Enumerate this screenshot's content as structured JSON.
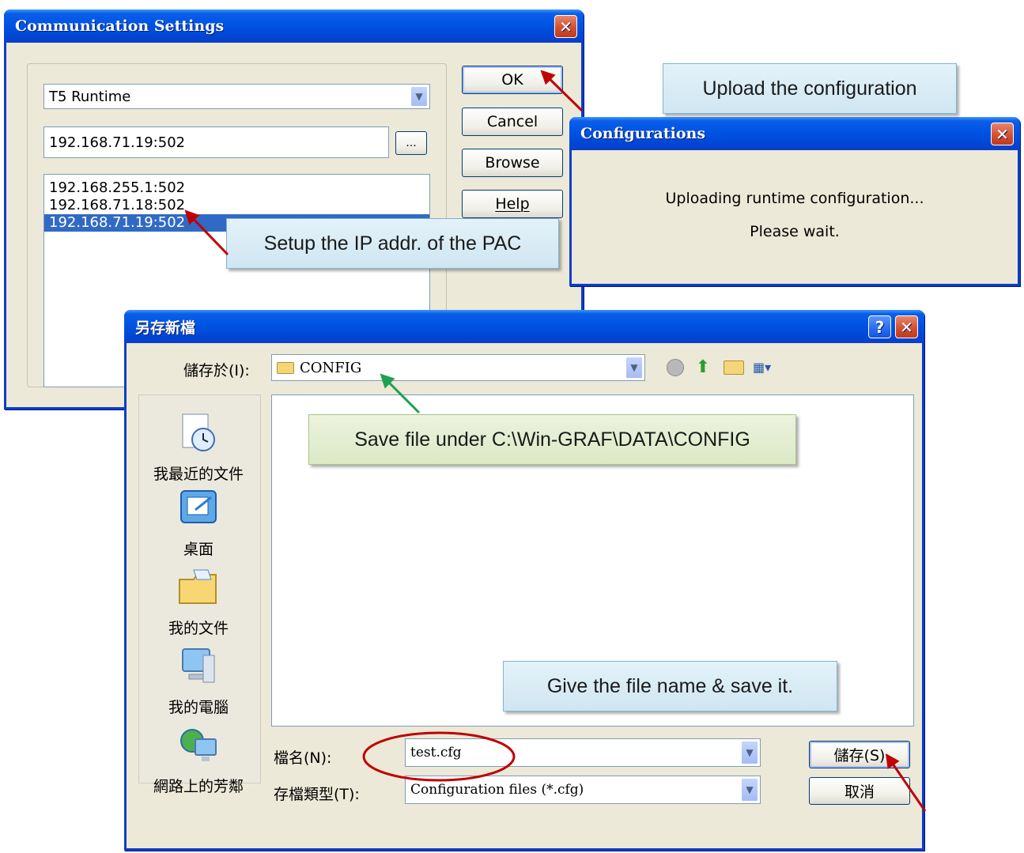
{
  "comm_dialog": {
    "title": "Communication Settings",
    "runtime_select": "T5 Runtime",
    "address_value": "192.168.71.19:502",
    "browse_dots": "...",
    "address_list": [
      "192.168.255.1:502",
      "192.168.71.18:502",
      "192.168.71.19:502"
    ],
    "selected_index": 2,
    "buttons": {
      "ok": "OK",
      "cancel": "Cancel",
      "browse": "Browse",
      "help": "Help",
      "help_mnemonic": "H"
    }
  },
  "config_dialog": {
    "title": "Configurations",
    "message_line1": "Uploading runtime configuration...",
    "message_line2": "Please wait."
  },
  "save_dialog": {
    "title": "另存新檔",
    "save_in_label": "儲存於(I):",
    "save_in_value": "CONFIG",
    "places": [
      {
        "label": "我最近的文件",
        "icon": "recent-documents-icon"
      },
      {
        "label": "桌面",
        "icon": "desktop-icon"
      },
      {
        "label": "我的文件",
        "icon": "my-documents-icon"
      },
      {
        "label": "我的電腦",
        "icon": "my-computer-icon"
      },
      {
        "label": "網路上的芳鄰",
        "icon": "network-places-icon"
      }
    ],
    "filename_label": "檔名(N):",
    "filename_value": "test.cfg",
    "filetype_label": "存檔類型(T):",
    "filetype_value": "Configuration files (*.cfg)",
    "save_button": "儲存(S)",
    "cancel_button": "取消"
  },
  "callouts": {
    "upload": "Upload the configuration",
    "setup_ip": "Setup the IP addr. of the PAC",
    "save_path": "Save file under C:\\Win-GRAF\\DATA\\CONFIG",
    "give_name": "Give the file name & save it."
  },
  "colors": {
    "xp_blue": "#0054e3",
    "dialog_bg": "#ece9d8",
    "selection": "#316ac5",
    "arrow_red": "#c00000",
    "arrow_green": "#20a050",
    "ellipse_red": "#c00000"
  }
}
